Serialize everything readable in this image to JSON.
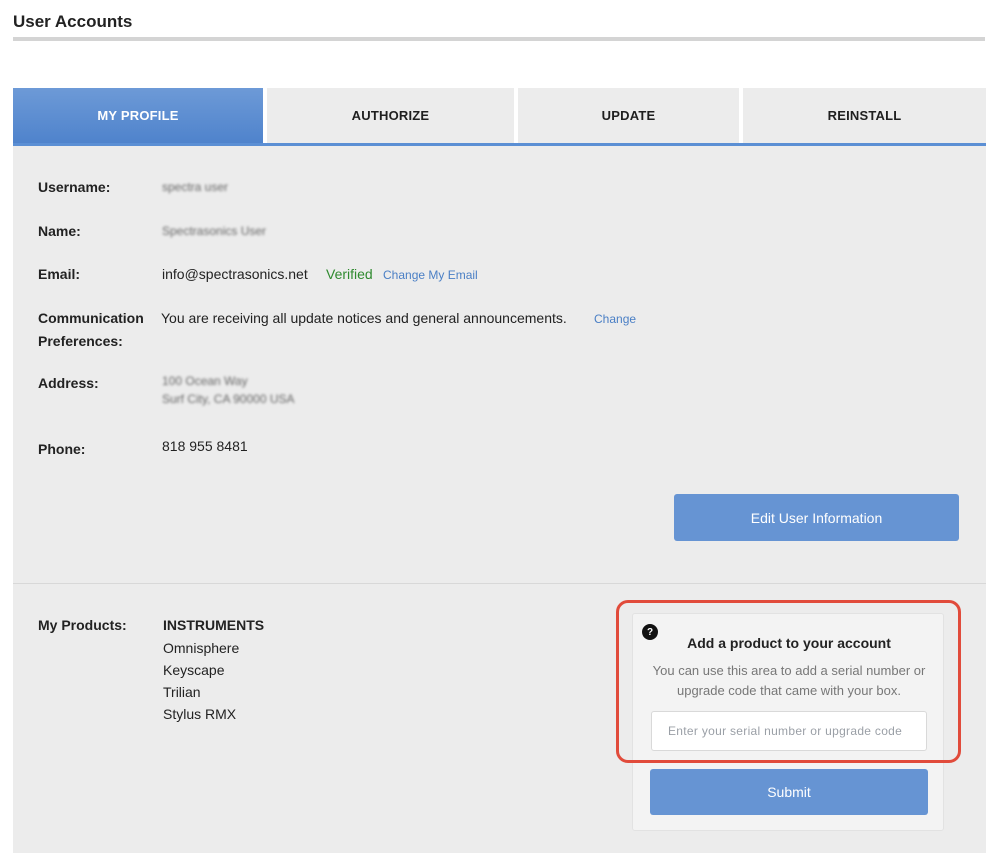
{
  "page": {
    "title": "User Accounts"
  },
  "tabs": [
    {
      "label": "MY PROFILE",
      "active": true
    },
    {
      "label": "AUTHORIZE",
      "active": false
    },
    {
      "label": "UPDATE",
      "active": false
    },
    {
      "label": "REINSTALL",
      "active": false
    }
  ],
  "profile": {
    "username": {
      "label": "Username:",
      "value": "spectra user"
    },
    "name": {
      "label": "Name:",
      "value": "Spectrasonics User"
    },
    "email": {
      "label": "Email:",
      "value": "info@spectrasonics.net",
      "status": "Verified",
      "change_link": "Change My Email"
    },
    "communication": {
      "label_line1": "Communication",
      "label_line2": "Preferences:",
      "value": "You are receiving all update notices and general announcements.",
      "change_link": "Change"
    },
    "address": {
      "label": "Address:",
      "line1": "100 Ocean Way",
      "line2": "Surf City, CA 90000 USA"
    },
    "phone": {
      "label": "Phone:",
      "value": "818 955 8481"
    },
    "edit_button": "Edit User Information"
  },
  "products": {
    "label": "My Products:",
    "category": "INSTRUMENTS",
    "items": [
      "Omnisphere",
      "Keyscape",
      "Trilian",
      "Stylus RMX"
    ]
  },
  "add_product": {
    "help_icon": "?",
    "title": "Add a product to your account",
    "description": "You can use this area to add a serial number or upgrade code that came with your box.",
    "input_placeholder": "Enter your serial number or upgrade code",
    "input_value": "",
    "submit_label": "Submit"
  },
  "colors": {
    "accent": "#5b8fd4",
    "button": "#6694d3",
    "verified": "#2f8a2f",
    "highlight": "#e14b3b"
  }
}
